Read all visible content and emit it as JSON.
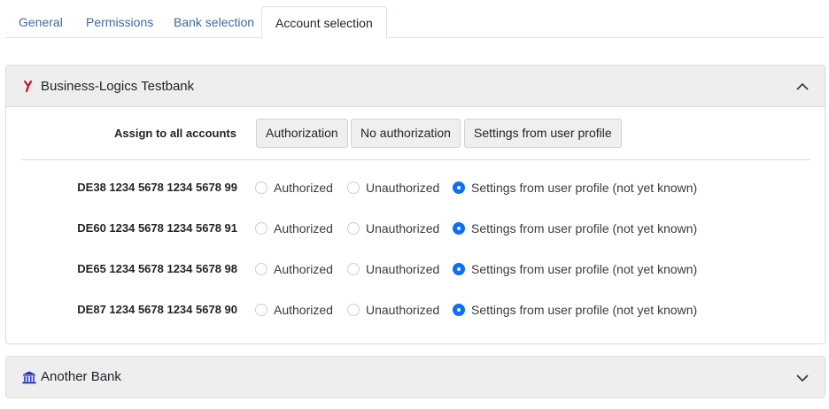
{
  "tabs": [
    {
      "label": "General",
      "active": false
    },
    {
      "label": "Permissions",
      "active": false
    },
    {
      "label": "Bank selection",
      "active": false
    },
    {
      "label": "Account selection",
      "active": true
    }
  ],
  "banks": [
    {
      "name": "Business-Logics Testbank",
      "icon": "bank-logo-icon",
      "expanded": true,
      "assign_label": "Assign to all accounts",
      "buttons": [
        "Authorization",
        "No authorization",
        "Settings from user profile"
      ],
      "option_labels": [
        "Authorized",
        "Unauthorized",
        "Settings from user profile (not yet known)"
      ],
      "accounts": [
        {
          "iban": "DE38 1234 5678 1234 5678 99",
          "selected": "Settings from user profile (not yet known)"
        },
        {
          "iban": "DE60 1234 5678 1234 5678 91",
          "selected": "Settings from user profile (not yet known)"
        },
        {
          "iban": "DE65 1234 5678 1234 5678 98",
          "selected": "Settings from user profile (not yet known)"
        },
        {
          "iban": "DE87 1234 5678 1234 5678 90",
          "selected": "Settings from user profile (not yet known)"
        }
      ]
    },
    {
      "name": "Another Bank",
      "icon": "bank-building-icon",
      "expanded": false
    }
  ],
  "colors": {
    "accent": "#0d6efd",
    "tab_link": "#3d6aa6",
    "header_bg": "#eeeeee",
    "logo_red": "#c8102e",
    "bank_icon_blue": "#1f2dbf"
  }
}
